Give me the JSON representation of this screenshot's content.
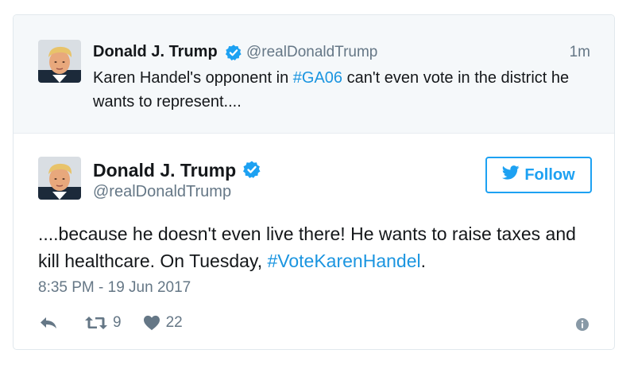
{
  "parent_tweet": {
    "author_name": "Donald J. Trump",
    "handle": "@realDonaldTrump",
    "timestamp": "1m",
    "text_before": "Karen Handel's opponent in ",
    "hashtag": "#GA06",
    "text_after": " can't even vote in the district he wants to represent...."
  },
  "main_tweet": {
    "author_name": "Donald J. Trump",
    "handle": "@realDonaldTrump",
    "follow_label": "Follow",
    "text_before": "....because he doesn't even live there! He wants to raise taxes and kill healthcare. On Tuesday, ",
    "hashtag": "#VoteKarenHandel",
    "text_after": ".",
    "date": "8:35 PM - 19 Jun 2017",
    "retweet_count": "9",
    "like_count": "22"
  },
  "icons": {
    "verified": "verified-badge-icon",
    "bird": "twitter-bird-icon",
    "reply": "reply-icon",
    "retweet": "retweet-icon",
    "like": "heart-icon",
    "info": "info-icon"
  },
  "colors": {
    "accent": "#1da1f2",
    "hashtag": "#1b95e0",
    "muted": "#657786",
    "parent_bg": "#f5f8fa",
    "text": "#14171a"
  }
}
